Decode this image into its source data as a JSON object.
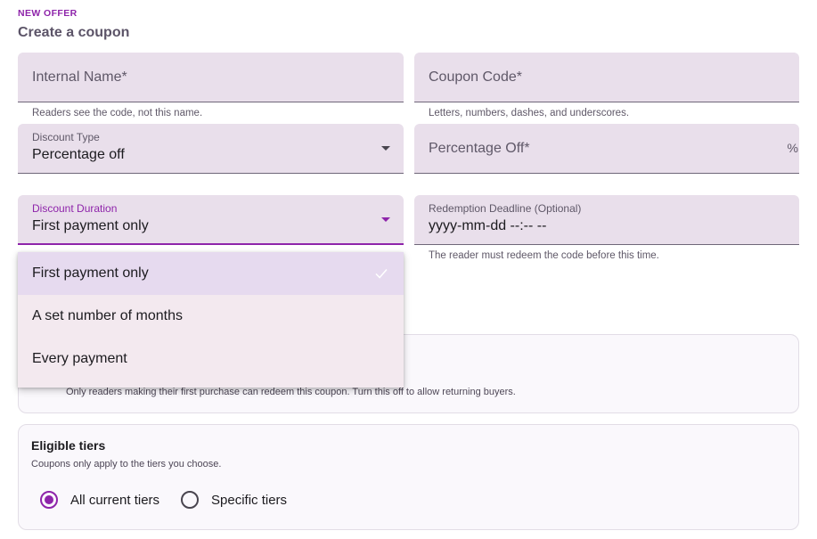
{
  "header": {
    "eyebrow": "NEW OFFER",
    "title": "Create a coupon"
  },
  "fields": {
    "internal_name": {
      "label": "Internal Name*",
      "helper": "Readers see the code, not this name."
    },
    "coupon_code": {
      "label": "Coupon Code*",
      "helper": "Letters, numbers, dashes, and underscores."
    },
    "discount_type": {
      "label": "Discount Type",
      "value": "Percentage off"
    },
    "percentage_off": {
      "label": "Percentage Off*",
      "suffix": "%"
    },
    "discount_duration": {
      "label": "Discount Duration",
      "value": "First payment only"
    },
    "redemption_deadline": {
      "label": "Redemption Deadline (Optional)",
      "value": "yyyy-mm-dd --:-- --",
      "helper": "The reader must redeem the code before this time."
    }
  },
  "duration_menu": {
    "options": [
      "First payment only",
      "A set number of months",
      "Every payment"
    ],
    "selected": "First payment only"
  },
  "first_purchase_card": {
    "description": "Only readers making their first purchase can redeem this coupon. Turn this off to allow returning buyers."
  },
  "eligible_tiers_card": {
    "title": "Eligible tiers",
    "description": "Coupons only apply to the tiers you choose.",
    "options": [
      "All current tiers",
      "Specific tiers"
    ],
    "selected": "All current tiers"
  },
  "colors": {
    "accent": "#8e24aa",
    "field_bg": "#e9dfeb",
    "menu_bg": "#f3e9ef",
    "menu_selected_bg": "#e6daef"
  }
}
